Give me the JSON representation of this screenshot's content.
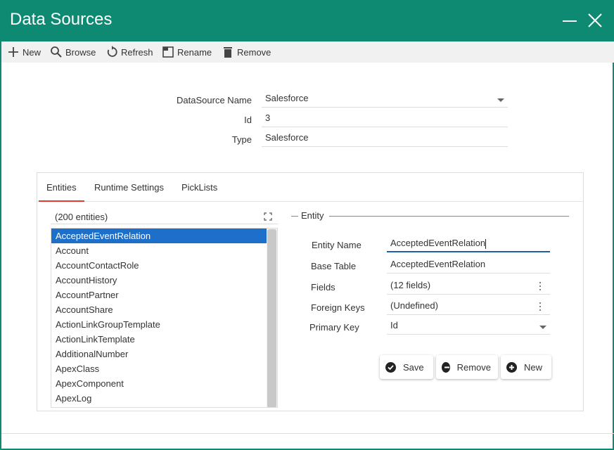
{
  "window": {
    "title": "Data Sources"
  },
  "toolbar": {
    "new": "New",
    "browse": "Browse",
    "refresh": "Refresh",
    "rename": "Rename",
    "remove": "Remove"
  },
  "form": {
    "name_label": "DataSource Name",
    "name_value": "Salesforce",
    "id_label": "Id",
    "id_value": "3",
    "type_label": "Type",
    "type_value": "Salesforce"
  },
  "tabs": [
    "Entities",
    "Runtime Settings",
    "PickLists"
  ],
  "entities": {
    "count_text": "(200 entities)",
    "items": [
      "AcceptedEventRelation",
      "Account",
      "AccountContactRole",
      "AccountHistory",
      "AccountPartner",
      "AccountShare",
      "ActionLinkGroupTemplate",
      "ActionLinkTemplate",
      "AdditionalNumber",
      "ApexClass",
      "ApexComponent",
      "ApexLog"
    ],
    "selected": "AcceptedEventRelation"
  },
  "entity": {
    "group_title": "Entity",
    "name_label": "Entity Name",
    "name_value": "AcceptedEventRelation",
    "base_label": "Base Table",
    "base_value": "AcceptedEventRelation",
    "fields_label": "Fields",
    "fields_value": "(12 fields)",
    "fk_label": "Foreign Keys",
    "fk_value": "(Undefined)",
    "pk_label": "Primary Key",
    "pk_value": "Id"
  },
  "actions": {
    "save": "Save",
    "remove": "Remove",
    "new": "New"
  },
  "colors": {
    "title_bar": "#0e8a73",
    "selection": "#1e6fc9",
    "active_tab": "#e53935",
    "group_rule": "#4caf50"
  }
}
